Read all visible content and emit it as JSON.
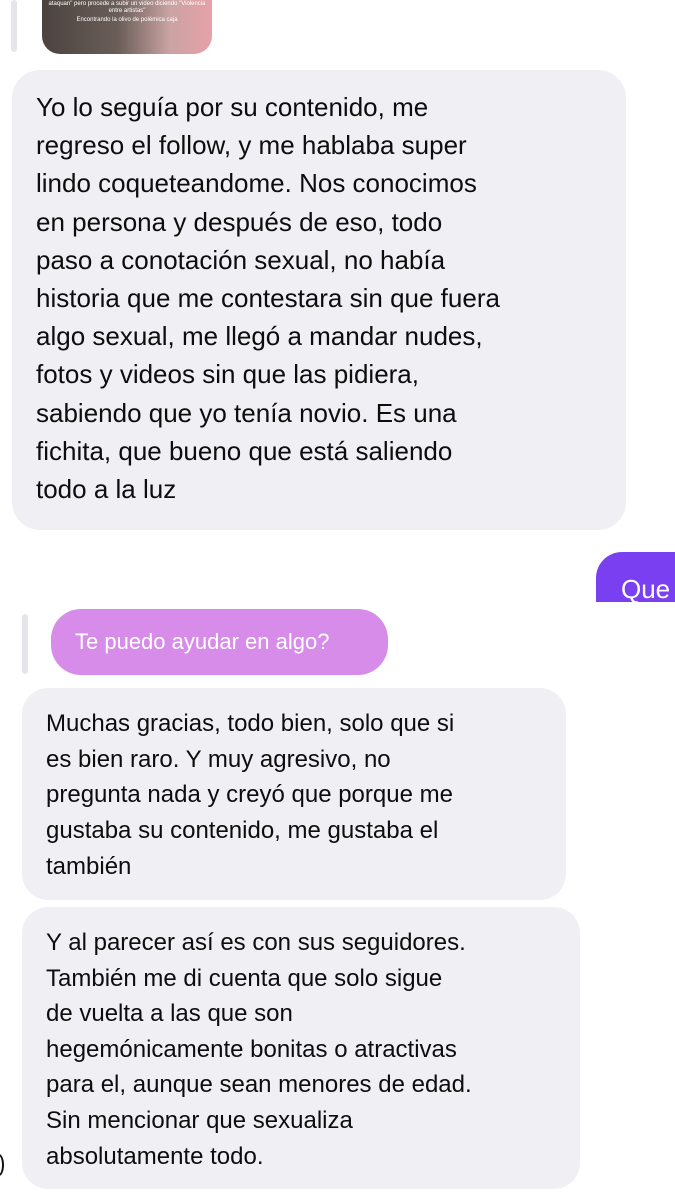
{
  "media_preview": {
    "caption_lines": [
      "ataquan\" pero procede a subir un video diciendo \"Violencia",
      "entre artistas\"",
      "Encontrando la olivo de polémica caja"
    ]
  },
  "messages": [
    {
      "direction": "received",
      "text": "Yo lo seguía por su contenido, me\nregreso el follow, y me hablaba super\nlindo coqueteandome. Nos conocimos\nen persona y después de eso, todo\npaso a conotación sexual, no había\nhistoria que me contestara sin que fuera\nalgo sexual, me llegó a mandar nudes,\nfotos y videos sin que las pidiera,\nsabiendo que yo tenía novio. Es una\nfichita, que bueno que está saliendo\ntodo a la luz"
    },
    {
      "direction": "sent",
      "text": "Que"
    },
    {
      "direction": "reply_preview",
      "text": "Te puedo ayudar en algo?"
    },
    {
      "direction": "received",
      "text": "Muchas gracias, todo bien, solo que si\nes bien raro. Y muy agresivo, no\npregunta nada y creyó que porque me\ngustaba su contenido, me gustaba el\ntambién"
    },
    {
      "direction": "received",
      "text": "Y al parecer así es con sus seguidores.\nTambién me di cuenta que solo sigue\nde vuelta a las que son\nhegemónicamente bonitas o atractivas\npara el, aunque sean menores de edad.\nSin mencionar que sexualiza\nabsolutamente todo."
    }
  ],
  "colors": {
    "received_bubble": "#f0f0f4",
    "sent_bubble": "#7b3ff2",
    "reply_preview_bubble": "#d68ce8",
    "reply_bar": "#e6e6ea"
  },
  "icons": {
    "reply_indicator": "reply-bar-icon"
  }
}
